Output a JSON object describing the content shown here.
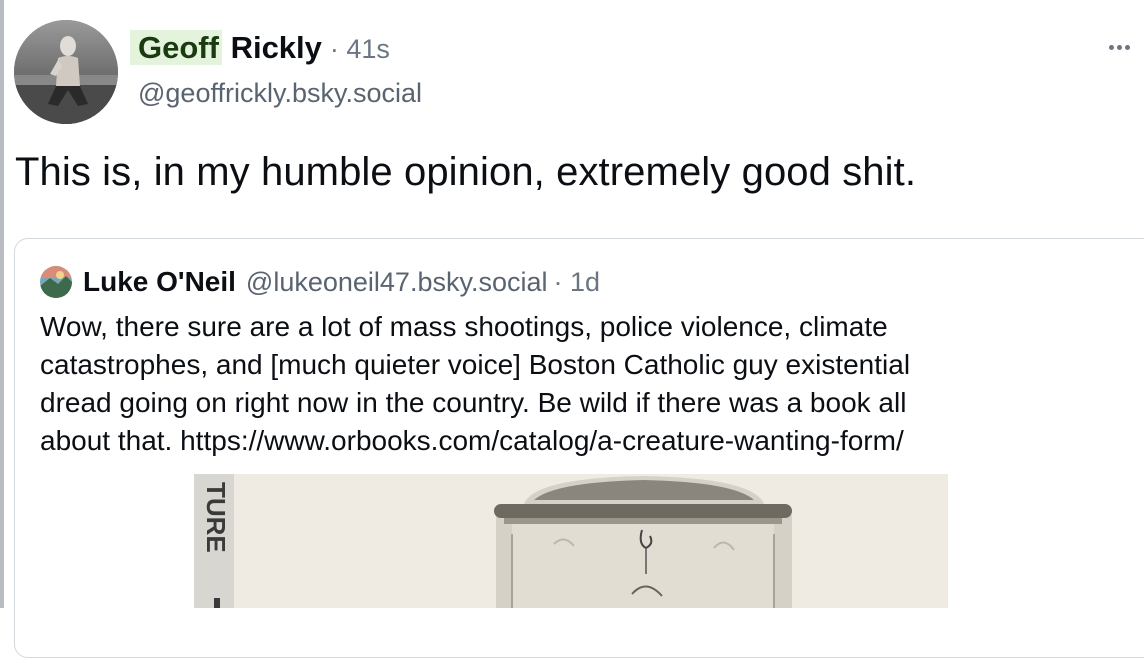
{
  "post": {
    "author": {
      "name_first": "Geoff",
      "name_last": "Rickly",
      "handle": "@geoffrickly.bsky.social",
      "time": "· 41s"
    },
    "text": "This is, in my humble opinion, extremely good shit.",
    "menu_icon": "more-horizontal-icon"
  },
  "quote": {
    "author": {
      "name": "Luke O'Neil",
      "handle": "@lukeoneil47.bsky.social",
      "time": "· 1d"
    },
    "body_lines": [
      "Wow, there sure are a lot of mass shootings, police violence, climate",
      "catastrophes, and [much quieter voice] Boston Catholic guy existential",
      "dread going on right now in the country. Be wild if there was a book all",
      "about that.  https://www.orbooks.com/catalog/a-creature-wanting-form/"
    ],
    "image": {
      "spine_text": "TURE",
      "description_icon": "book-cover-image"
    }
  },
  "colors": {
    "highlight": "#e4f4dc",
    "muted_text": "#6b7682",
    "border": "#d4d9de"
  }
}
